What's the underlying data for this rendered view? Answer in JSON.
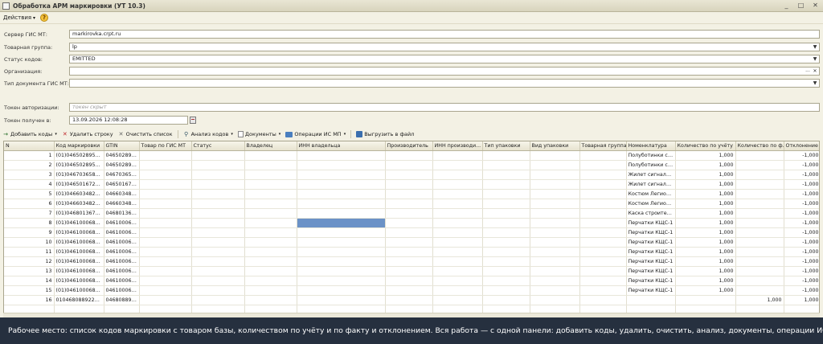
{
  "window": {
    "title": "Обработка  АРМ маркировки (УТ 10.3)",
    "minimize": "_",
    "maximize": "□",
    "close": "✕"
  },
  "menu": {
    "actions": "Действия",
    "help": "?"
  },
  "form": {
    "server_label": "Сервер ГИС МТ:",
    "server_value": "markirovka.crpt.ru",
    "group_label": "Товарная группа:",
    "group_value": "lp",
    "status_label": "Статус кодов:",
    "status_value": "EMITTED",
    "org_label": "Организация:",
    "org_value": "",
    "doctype_label": "Тип документа ГИС МТ:",
    "doctype_value": "",
    "token_label": "Токен авторизации:",
    "token_placeholder": "токен скрыт",
    "token_time_label": "Токен получен в:",
    "token_time_value": "13.09.2026 12:08:28"
  },
  "toolbar": {
    "add": "Добавить коды",
    "delete_row": "Удалить строку",
    "clear": "Очистить список",
    "analysis": "Анализ кодов",
    "documents": "Документы",
    "operations": "Операции ИС МП",
    "export": "Выгрузить в файл"
  },
  "table": {
    "columns": [
      "N",
      "Код маркировки",
      "GTIN",
      "Товар по ГИС МТ",
      "Статус",
      "Владелец",
      "ИНН владельца",
      "Производитель",
      "ИНН производи...",
      "Тип упаковки",
      "Вид упаковки",
      "Товарная группа",
      "Номенклатура",
      "Количество по учёту",
      "Количество по ф...",
      "Отклонение"
    ],
    "rows": [
      {
        "n": "1",
        "code": "(01)04650289560...",
        "gtin": "046502895...",
        "nom": "Полуботинки  с ...",
        "qty": "1,000",
        "fact": "",
        "dev": "-1,000"
      },
      {
        "n": "2",
        "code": "(01)04650289560...",
        "gtin": "046502895...",
        "nom": "Полуботинки  с ...",
        "qty": "1,000",
        "fact": "",
        "dev": "-1,000"
      },
      {
        "n": "3",
        "code": "(01)04670365852...",
        "gtin": "046703658...",
        "nom": "Жилет сигналь...",
        "qty": "1,000",
        "fact": "",
        "dev": "-1,000"
      },
      {
        "n": "4",
        "code": "(01)04650167231...",
        "gtin": "046501672...",
        "nom": "Жилет сигналь...",
        "qty": "1,000",
        "fact": "",
        "dev": "-1,000"
      },
      {
        "n": "5",
        "code": "(01)04660348250...",
        "gtin": "046603482...",
        "nom": "Костюм Легион...",
        "qty": "1,000",
        "fact": "",
        "dev": "-1,000"
      },
      {
        "n": "6",
        "code": "(01)04660348250...",
        "gtin": "046603482...",
        "nom": "Костюм Легион...",
        "qty": "1,000",
        "fact": "",
        "dev": "-1,000"
      },
      {
        "n": "7",
        "code": "(01)04680136760...",
        "gtin": "046801367...",
        "nom": "Каска строител...",
        "qty": "1,000",
        "fact": "",
        "dev": "-1,000"
      },
      {
        "n": "8",
        "code": "(01)04610006884...",
        "gtin": "046100068...",
        "nom": "Перчатки КЩС-1",
        "qty": "1,000",
        "fact": "",
        "dev": "-1,000"
      },
      {
        "n": "9",
        "code": "(01)04610006884...",
        "gtin": "046100068...",
        "nom": "Перчатки КЩС-1",
        "qty": "1,000",
        "fact": "",
        "dev": "-1,000"
      },
      {
        "n": "10",
        "code": "(01)04610006884...",
        "gtin": "046100068...",
        "nom": "Перчатки КЩС-1",
        "qty": "1,000",
        "fact": "",
        "dev": "-1,000"
      },
      {
        "n": "11",
        "code": "(01)04610006884...",
        "gtin": "046100068...",
        "nom": "Перчатки КЩС-1",
        "qty": "1,000",
        "fact": "",
        "dev": "-1,000"
      },
      {
        "n": "12",
        "code": "(01)04610006884...",
        "gtin": "046100068...",
        "nom": "Перчатки КЩС-1",
        "qty": "1,000",
        "fact": "",
        "dev": "-1,000"
      },
      {
        "n": "13",
        "code": "(01)04610006884...",
        "gtin": "046100068...",
        "nom": "Перчатки КЩС-1",
        "qty": "1,000",
        "fact": "",
        "dev": "-1,000"
      },
      {
        "n": "14",
        "code": "(01)04610006884...",
        "gtin": "046100068...",
        "nom": "Перчатки КЩС-1",
        "qty": "1,000",
        "fact": "",
        "dev": "-1,000"
      },
      {
        "n": "15",
        "code": "(01)04610006884...",
        "gtin": "046100068...",
        "nom": "Перчатки КЩС-1",
        "qty": "1,000",
        "fact": "",
        "dev": "-1,000"
      },
      {
        "n": "16",
        "code": "01046808892207...",
        "gtin": "046808892...",
        "nom": "",
        "qty": "",
        "fact": "1,000",
        "dev": "1,000"
      }
    ]
  },
  "caption": "Рабочее место: список кодов маркировки с товаром базы, количеством по учёту и по факту и отклонением. Вся работа — с одной панели: добавить коды, удалить, очистить, анализ, документы, операции ИС МП и выгрузка"
}
